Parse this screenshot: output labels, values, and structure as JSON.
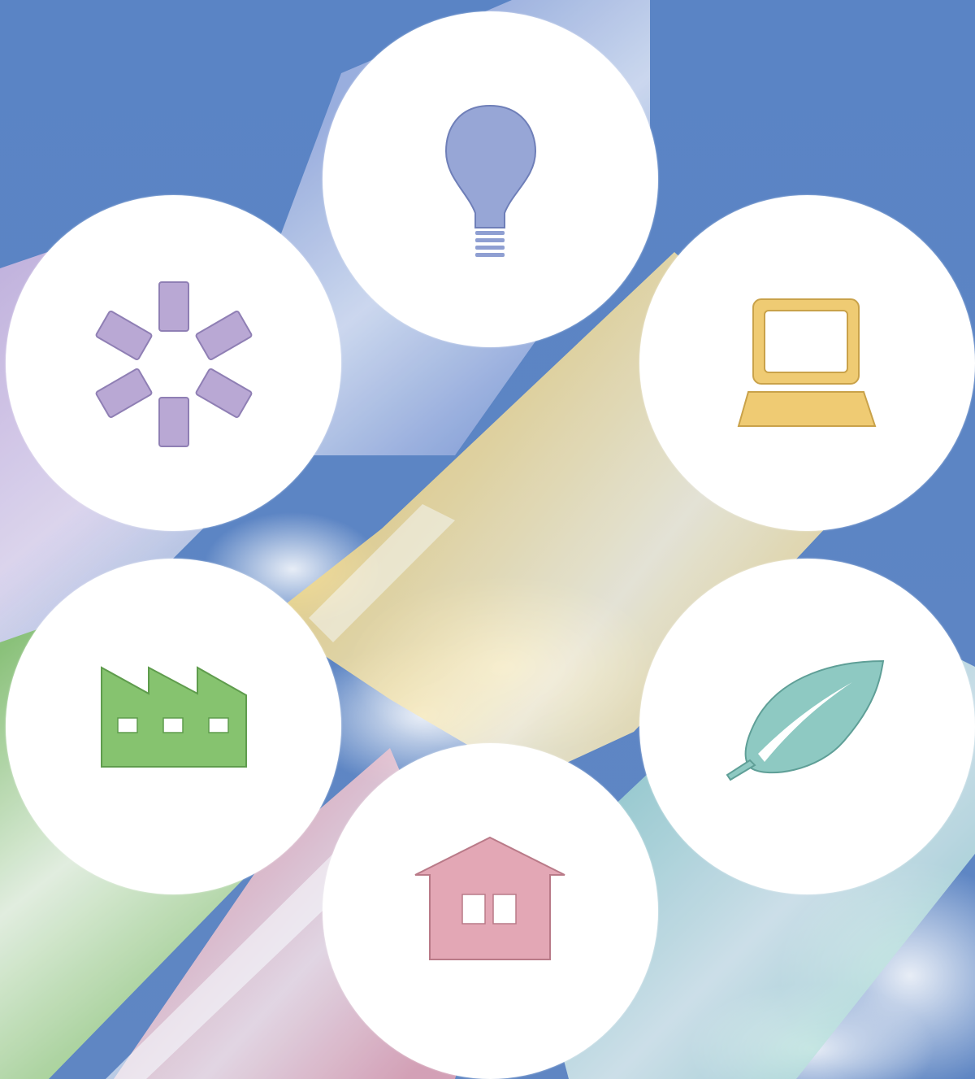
{
  "background": {
    "sky_color": "#5b83c4",
    "band_colors": {
      "lavender": "#c3b1dc",
      "blue": "#9fb0df",
      "yellow": "#f2d47a",
      "teal": "#8fcfc6",
      "green": "#8fc679",
      "pink": "#e6a4b3"
    }
  },
  "icons": [
    {
      "name": "light-bulb-icon",
      "color": "#97a6d6"
    },
    {
      "name": "gear-icon",
      "color": "#b9a8d4"
    },
    {
      "name": "laptop-icon",
      "color": "#efcb73"
    },
    {
      "name": "factory-icon",
      "color": "#86c36f"
    },
    {
      "name": "leaf-icon",
      "color": "#8ec9c2"
    },
    {
      "name": "house-icon",
      "color": "#e3a7b5"
    }
  ]
}
